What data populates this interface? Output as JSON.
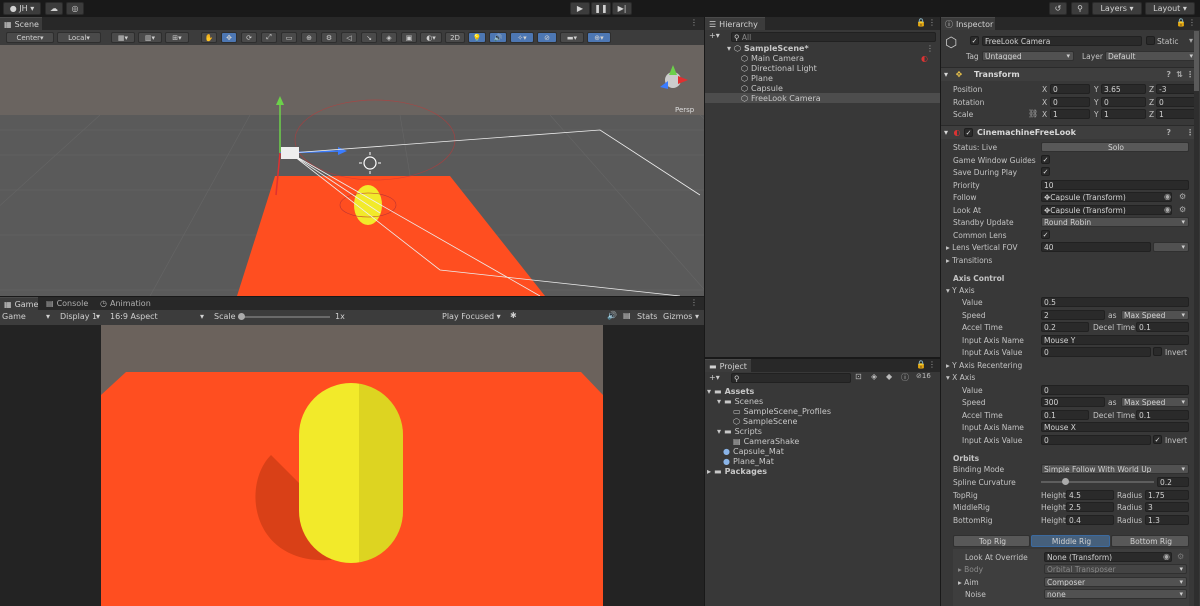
{
  "topbar": {
    "account": "JH",
    "layers": "Layers",
    "layout": "Layout"
  },
  "scene": {
    "tab": "Scene",
    "pivot": "Center",
    "space": "Local",
    "mode2d": "2D",
    "persp": "Persp"
  },
  "game": {
    "tab_game": "Game",
    "tab_console": "Console",
    "tab_animation": "Animation",
    "view": "Game",
    "display": "Display 1",
    "aspect": "16:9 Aspect",
    "scale_label": "Scale",
    "scale_value": "1x",
    "play_focused": "Play Focused",
    "stats": "Stats",
    "gizmos": "Gizmos"
  },
  "hierarchy": {
    "tab": "Hierarchy",
    "search": "All",
    "scene": "SampleScene*",
    "items": [
      "Main Camera",
      "Directional Light",
      "Plane",
      "Capsule",
      "FreeLook Camera"
    ]
  },
  "project": {
    "tab": "Project",
    "count": "16",
    "assets": "Assets",
    "scenes_folder": "Scenes",
    "profiles": "SampleScene_Profiles",
    "samplescene": "SampleScene",
    "scripts_folder": "Scripts",
    "camerashake": "CameraShake",
    "capsule_mat": "Capsule_Mat",
    "plane_mat": "Plane_Mat",
    "packages": "Packages"
  },
  "inspector": {
    "tab": "Inspector",
    "object_name": "FreeLook Camera",
    "static": "Static",
    "tag_label": "Tag",
    "tag": "Untagged",
    "layer_label": "Layer",
    "layer": "Default",
    "transform": {
      "title": "Transform",
      "position": "Position",
      "rotation": "Rotation",
      "scale": "Scale",
      "x": "X",
      "y": "Y",
      "z": "Z",
      "pos": [
        "0",
        "3.65",
        "-3"
      ],
      "rot": [
        "0",
        "0",
        "0"
      ],
      "scl": [
        "1",
        "1",
        "1"
      ]
    },
    "cm": {
      "title": "CinemachineFreeLook",
      "status": "Status: Live",
      "solo": "Solo",
      "guides": "Game Window Guides",
      "save": "Save During Play",
      "priority_label": "Priority",
      "priority": "10",
      "follow_label": "Follow",
      "follow": "Capsule (Transform)",
      "lookat_label": "Look At",
      "lookat": "Capsule (Transform)",
      "standby_label": "Standby Update",
      "standby": "Round Robin",
      "common_lens": "Common Lens",
      "fov_label": "Lens Vertical FOV",
      "fov": "40",
      "transitions": "Transitions",
      "axis_control": "Axis Control",
      "y_axis": {
        "title": "Y Axis",
        "value": "0.5",
        "speed": "2",
        "as": "as",
        "speed_mode": "Max Speed",
        "accel": "0.2",
        "decel": "0.1",
        "name": "Mouse Y",
        "input_value": "0",
        "invert": "Invert"
      },
      "y_recentering": "Y Axis Recentering",
      "x_axis": {
        "title": "X Axis",
        "value": "0",
        "speed": "300",
        "as": "as",
        "speed_mode": "Max Speed",
        "accel": "0.1",
        "decel": "0.1",
        "name": "Mouse X",
        "input_value": "0",
        "invert": "Invert"
      },
      "labels": {
        "value": "Value",
        "speed": "Speed",
        "accel": "Accel Time",
        "decel": "Decel Time",
        "input_name": "Input Axis Name",
        "input_value": "Input Axis Value"
      },
      "orbits": "Orbits",
      "binding_label": "Binding Mode",
      "binding": "Simple Follow With World Up",
      "spline_label": "Spline Curvature",
      "spline": "0.2",
      "height": "Height",
      "radius": "Radius",
      "rigs": [
        {
          "name": "TopRig",
          "h": "4.5",
          "r": "1.75"
        },
        {
          "name": "MiddleRig",
          "h": "2.5",
          "r": "3"
        },
        {
          "name": "BottomRig",
          "h": "0.4",
          "r": "1.3"
        }
      ],
      "rig_tabs": [
        "Top Rig",
        "Middle Rig",
        "Bottom Rig"
      ],
      "override_label": "Look At Override",
      "override": "None (Transform)",
      "body_label": "Body",
      "body": "Orbital Transposer",
      "aim_label": "Aim",
      "aim": "Composer",
      "noise_label": "Noise",
      "noise": "none"
    }
  },
  "colors": {
    "accent": "#4d77b3",
    "plane": "#ff4e20",
    "capsule": "#f2ea2a",
    "sky": "#6b625c",
    "ground": "#5a5a5a"
  }
}
